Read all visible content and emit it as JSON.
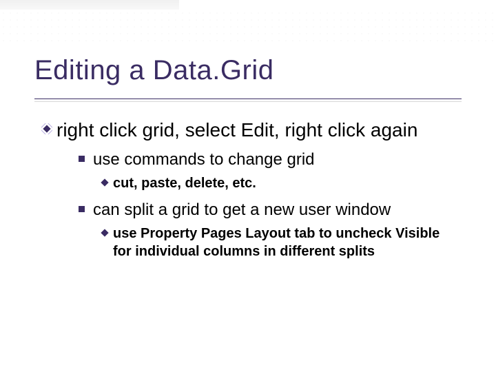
{
  "title": "Editing a Data.Grid",
  "bullets": {
    "lvl1_0": "right click grid, select Edit, right click again",
    "lvl2_0": "use commands to change grid",
    "lvl3_0": "cut, paste, delete, etc.",
    "lvl2_1": "can split a grid to get a new user window",
    "lvl3_1": "use Property Pages Layout tab to uncheck Visible for individual columns in different splits"
  }
}
